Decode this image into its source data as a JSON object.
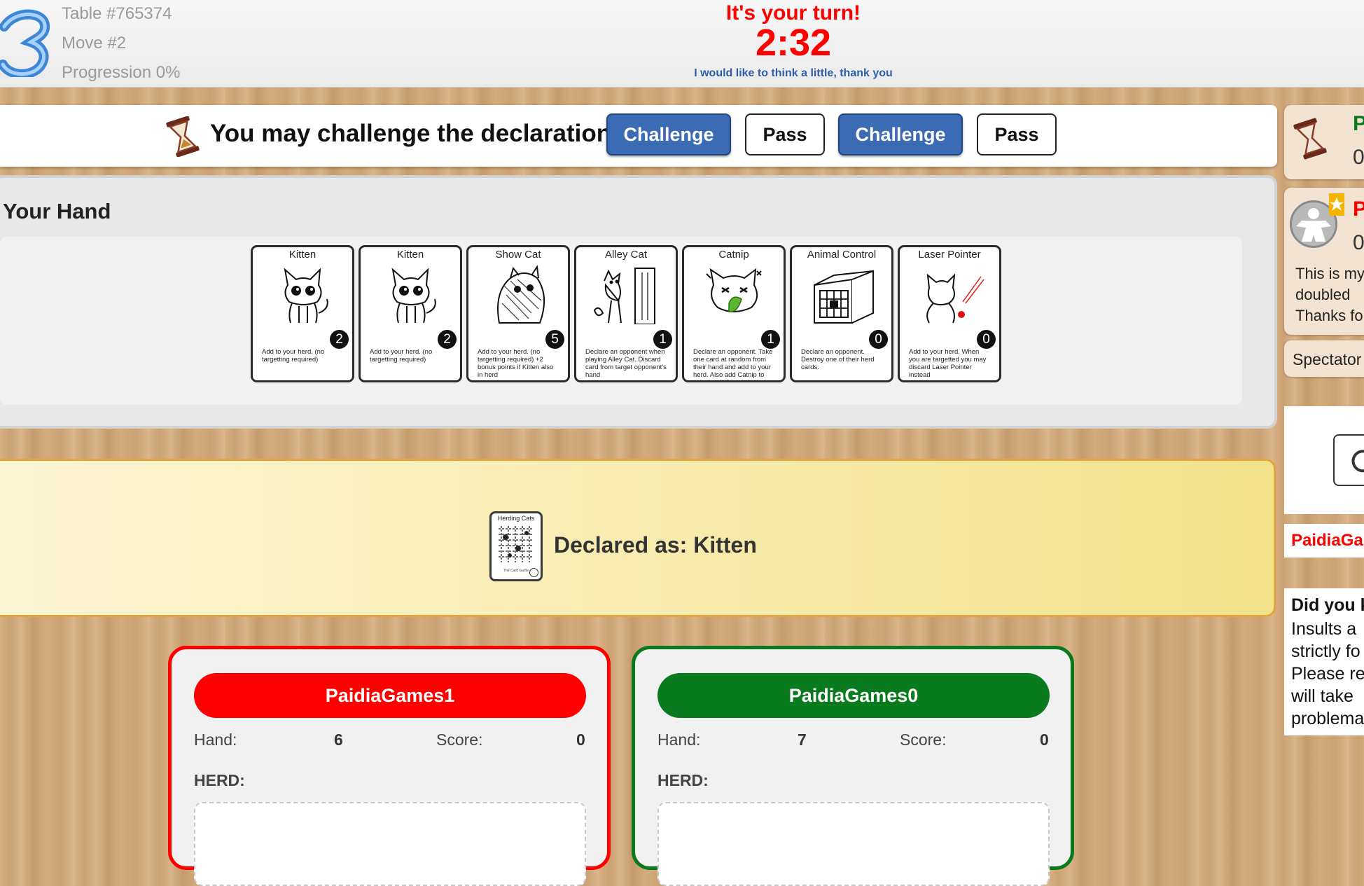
{
  "header": {
    "table": "Table #765374",
    "move": "Move #2",
    "progression": "Progression 0%",
    "turn_message": "It's your turn!",
    "timer": "2:32",
    "think_link": "I would like to think a little, thank you"
  },
  "action_bar": {
    "message": "You may challenge the declaration",
    "challenge1": "Challenge",
    "pass1": "Pass",
    "challenge2": "Challenge",
    "pass2": "Pass"
  },
  "hand": {
    "title": "Your Hand",
    "cards": [
      {
        "name": "Kitten",
        "value": "2",
        "text": "Add to your herd. (no targetting required)"
      },
      {
        "name": "Kitten",
        "value": "2",
        "text": "Add to your herd. (no targetting required)"
      },
      {
        "name": "Show Cat",
        "value": "5",
        "text": "Add to your herd. (no targetting required) +2 bonus points if Kitten also in herd"
      },
      {
        "name": "Alley Cat",
        "value": "1",
        "text": "Declare an opponent when playing Alley Cat. Discard card from target opponent's hand"
      },
      {
        "name": "Catnip",
        "value": "1",
        "text": "Declare an opponent. Take one card at random from their hand and add to your herd. Also add Catnip to your herd. Cannot be targeted by Catnip"
      },
      {
        "name": "Animal Control",
        "value": "0",
        "text": "Declare an opponent. Destroy one of their herd cards."
      },
      {
        "name": "Laser Pointer",
        "value": "0",
        "text": "Add to your herd. When you are targetted you may discard Laser Pointer instead"
      }
    ]
  },
  "declared": {
    "card_name": "Herding Cats",
    "card_footer": "The Card Game",
    "text": "Declared as: Kitten"
  },
  "players": [
    {
      "name": "PaidiaGames1",
      "color": "#ff0000",
      "hand_label": "Hand:",
      "hand": "6",
      "score_label": "Score:",
      "score": "0",
      "herd_label": "HERD:"
    },
    {
      "name": "PaidiaGames0",
      "color": "#0a7a1f",
      "hand_label": "Hand:",
      "hand": "7",
      "score_label": "Score:",
      "score": "0",
      "herd_label": "HERD:"
    }
  ],
  "sidebar": {
    "player1_initial": "P",
    "player1_score": "0",
    "player2_initial": "P",
    "player2_score": "0",
    "note": "This is my\ndoubled\nThanks fo",
    "spectators": "Spectator",
    "chat_name": "PaidiaGa",
    "tip_title": "Did you k",
    "tip_text": "Insults a\nstrictly fo\nPlease re\nwill take\nproblema"
  },
  "colors": {
    "accent_blue": "#3a6bb3",
    "red": "#ff0000",
    "green": "#0a7a1f",
    "link_blue": "#2e5ea8"
  }
}
